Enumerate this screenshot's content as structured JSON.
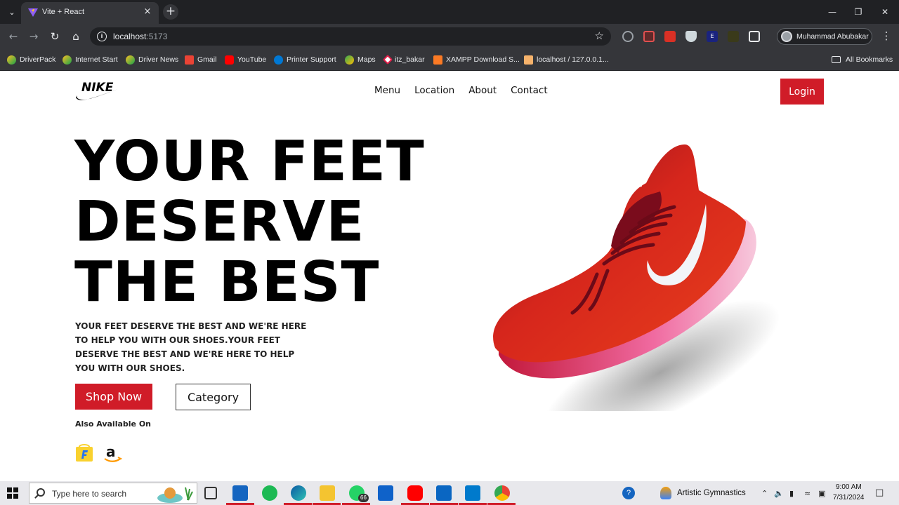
{
  "browser": {
    "tab_title": "Vite + React",
    "url_host": "localhost",
    "url_port": ":5173",
    "profile_name": "Muhammad Abubakar",
    "bookmarks": [
      "DriverPack",
      "Internet Start",
      "Driver News",
      "Gmail",
      "YouTube",
      "Printer Support",
      "Maps",
      "itz_bakar",
      "XAMPP Download S...",
      "localhost / 127.0.0.1..."
    ],
    "all_bookmarks": "All Bookmarks"
  },
  "site": {
    "nav": [
      "Menu",
      "Location",
      "About",
      "Contact"
    ],
    "login_label": "Login",
    "hero_lines": [
      "YOUR FEET",
      "DESERVE",
      "THE BEST"
    ],
    "hero_desc": "YOUR FEET DESERVE THE BEST AND WE'RE HERE TO HELP YOU WITH OUR SHOES.YOUR FEET DESERVE THE BEST AND WE'RE HERE TO HELP YOU WITH OUR SHOES.",
    "shop_label": "Shop Now",
    "category_label": "Category",
    "also_available": "Also Available On",
    "logo_text": "NIKE",
    "shoe_brand_text": "NIKE"
  },
  "taskbar": {
    "search_placeholder": "Type here to search",
    "whatsapp_badge": "66",
    "weather_label": "Artistic Gymnastics",
    "time": "9:00 AM",
    "date": "7/31/2024"
  },
  "colors": {
    "brand_red": "#d01c28",
    "chrome_dark": "#202124",
    "chrome_toolbar": "#35363a"
  }
}
